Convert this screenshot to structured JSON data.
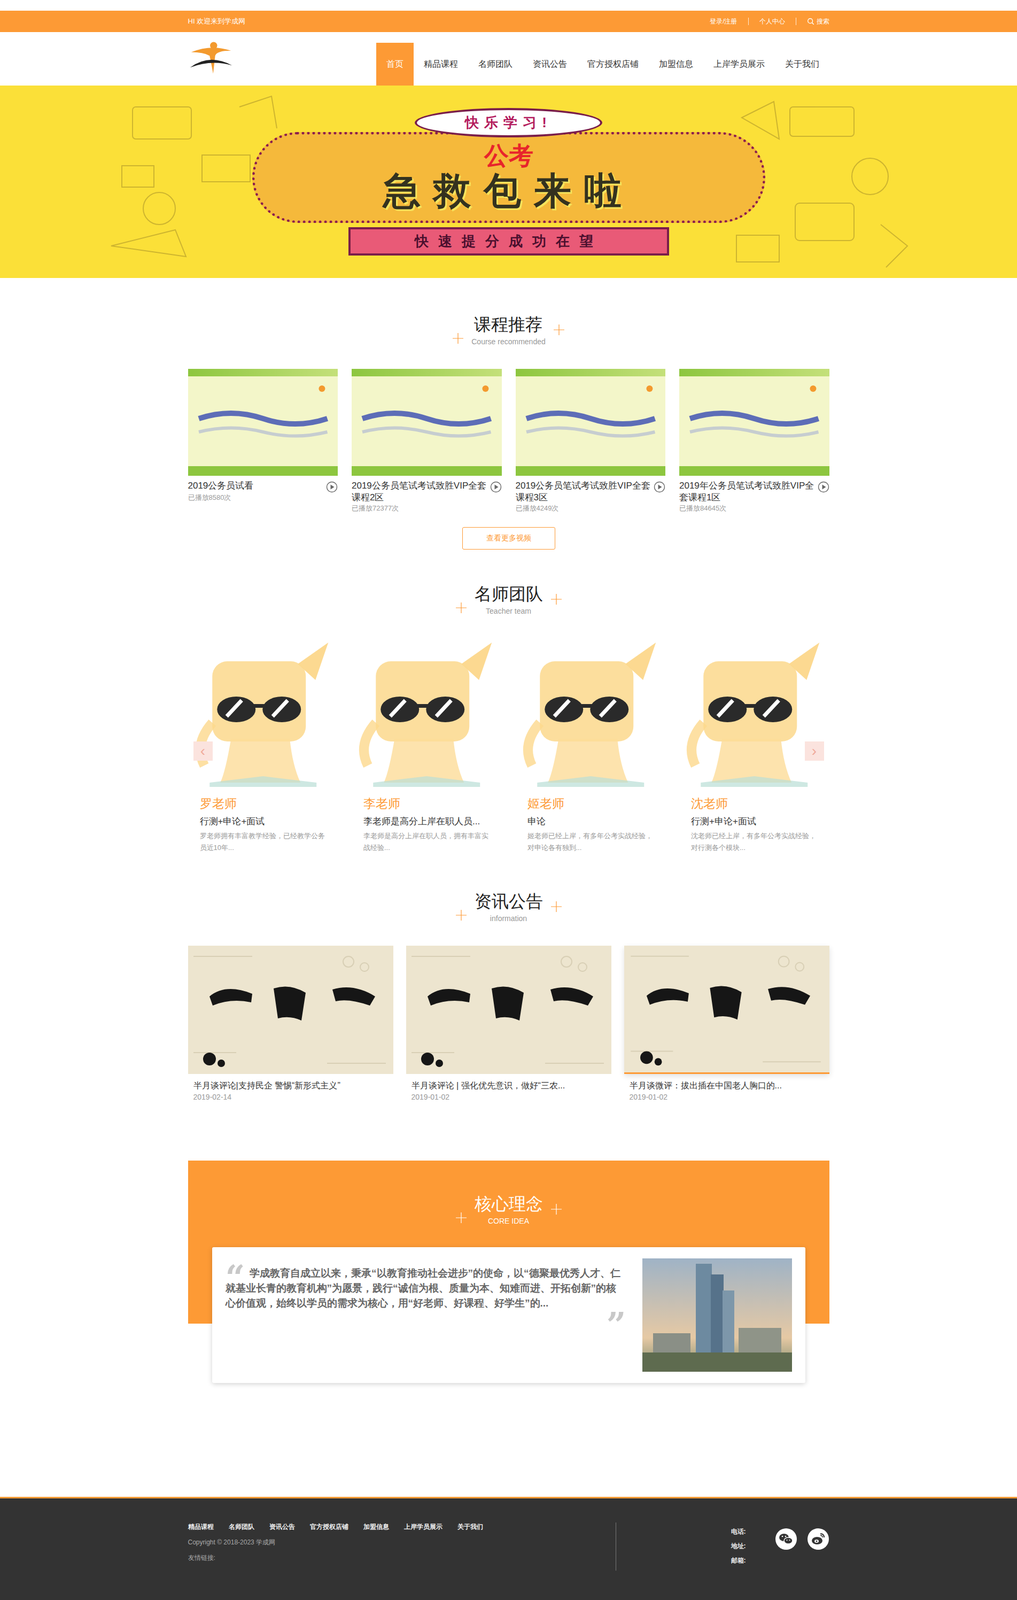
{
  "topbar": {
    "welcome": "HI 欢迎来到学成网",
    "links": [
      "登录/注册",
      "个人中心"
    ],
    "search": "搜索"
  },
  "nav": [
    {
      "label": "首页",
      "selected": true
    },
    {
      "label": "精品课程",
      "selected": false
    },
    {
      "label": "名师团队",
      "selected": false
    },
    {
      "label": "资讯公告",
      "selected": false
    },
    {
      "label": "官方授权店铺",
      "selected": false
    },
    {
      "label": "加盟信息",
      "selected": false
    },
    {
      "label": "上岸学员展示",
      "selected": false
    },
    {
      "label": "关于我们",
      "selected": false
    }
  ],
  "banner": {
    "bubble": "快乐学习!",
    "highlight": "公考",
    "headline": "急救包来啦",
    "ribbon": "快速提分成功在望"
  },
  "courses": {
    "title": "课程推荐",
    "subtitle": "Course recommended",
    "more": "查看更多视频",
    "items": [
      {
        "name": "2019公务员试看",
        "plays": "已播放8580次"
      },
      {
        "name": "2019公务员笔试考试致胜VIP全套课程2区",
        "plays": "已播放72377次"
      },
      {
        "name": "2019公务员笔试考试致胜VIP全套课程3区",
        "plays": "已播放4249次"
      },
      {
        "name": "2019年公务员笔试考试致胜VIP全套课程1区",
        "plays": "已播放84645次"
      }
    ]
  },
  "teachers": {
    "title": "名师团队",
    "subtitle": "Teacher team",
    "prev": "‹",
    "next": "›",
    "items": [
      {
        "name": "罗老师",
        "subject": "行测+申论+面试",
        "desc": "罗老师拥有丰富教学经验，已经教学公务员近10年..."
      },
      {
        "name": "李老师",
        "subject": "李老师是高分上岸在职人员...",
        "desc": "李老师是高分上岸在职人员，拥有丰富实战经验..."
      },
      {
        "name": "姬老师",
        "subject": "申论",
        "desc": "姬老师已经上岸，有多年公考实战经验，对申论各有独到..."
      },
      {
        "name": "沈老师",
        "subject": "行测+申论+面试",
        "desc": "沈老师已经上岸，有多年公考实战经验，对行测各个模块..."
      }
    ]
  },
  "news": {
    "title": "资讯公告",
    "subtitle": "information",
    "items": [
      {
        "title": "半月谈评论|支持民企 警惕“新形式主义”",
        "date": "2019-02-14",
        "highlighted": false
      },
      {
        "title": "半月谈评论 | 强化优先意识，做好“三农...",
        "date": "2019-01-02",
        "highlighted": false
      },
      {
        "title": "半月谈微评：拔出插在中国老人胸口的...",
        "date": "2019-01-02",
        "highlighted": true
      }
    ]
  },
  "core": {
    "title": "核心理念",
    "subtitle": "CORE IDEA",
    "open_quote": "“",
    "close_quote": "”",
    "text": "学成教育自成立以来，秉承“以教育推动社会进步”的使命，以“德聚最优秀人才、仁就基业长青的教育机构”为愿景，践行“诚信为根、质量为本、知难而进、开拓创新”的核心价值观，始终以学员的需求为核心，用“好老师、好课程、好学生”的..."
  },
  "footer": {
    "links": [
      "精品课程",
      "名师团队",
      "资讯公告",
      "官方授权店铺",
      "加盟信息",
      "上岸学员展示",
      "关于我们"
    ],
    "copyright": "Copyright © 2018-2023 学成网",
    "friends": "友情链接:",
    "contacts": [
      "电话:",
      "地址:",
      "邮箱:"
    ]
  }
}
